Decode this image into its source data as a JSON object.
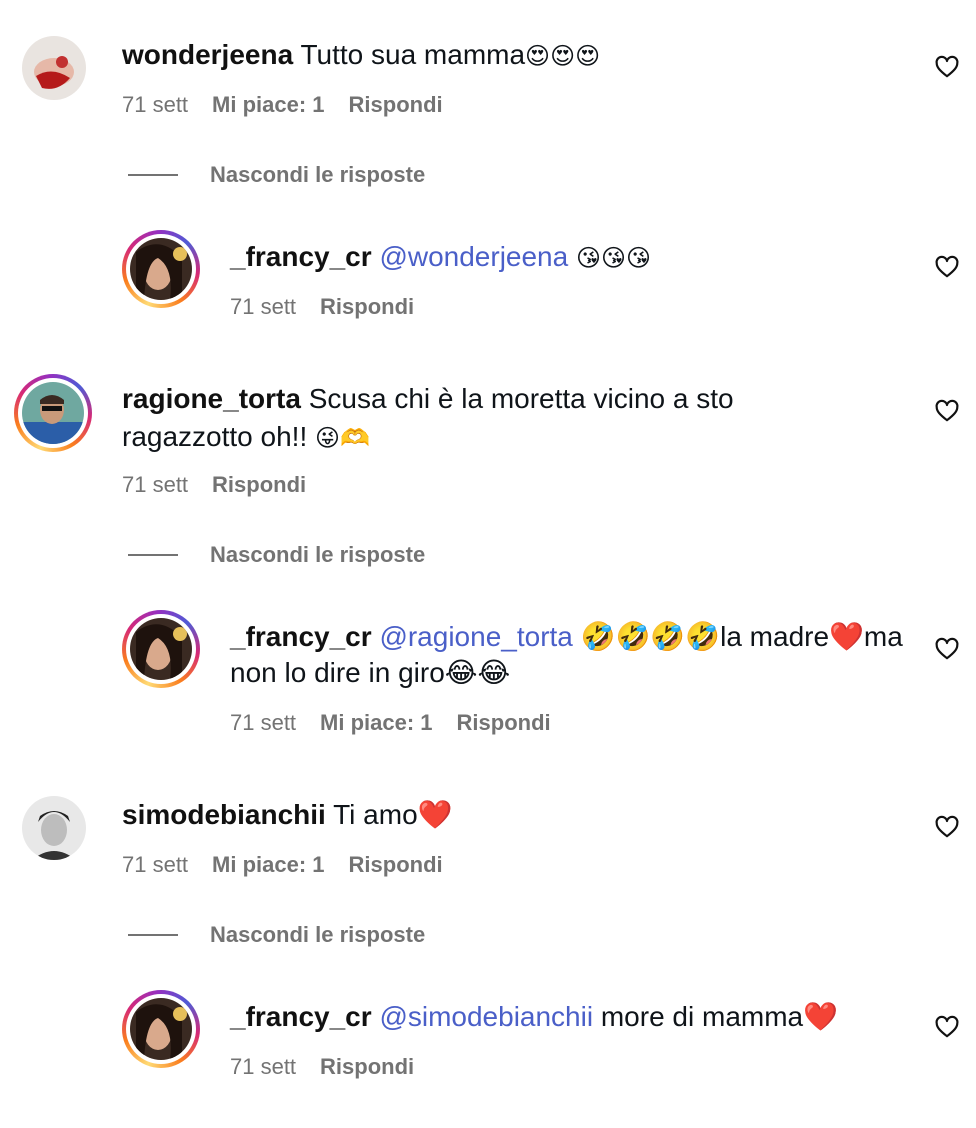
{
  "comments": [
    {
      "username": "wonderjeena",
      "text": "Tutto sua mamma",
      "emoji": "😍😍😍",
      "time": "71 sett",
      "likes": "Mi piace: 1",
      "reply": "Rispondi",
      "toggle": "Nascondi le risposte",
      "replies": [
        {
          "username": "_francy_cr",
          "mention": "@wonderjeena",
          "text": "",
          "emoji": "😘😘😘",
          "time": "71 sett",
          "reply": "Rispondi"
        }
      ]
    },
    {
      "username": "ragione_torta",
      "text": "Scusa chi è la moretta vicino a sto",
      "text2": "ragazzotto oh!!",
      "emoji": "😜🫶",
      "time": "71 sett",
      "reply": "Rispondi",
      "toggle": "Nascondi le risposte",
      "replies": [
        {
          "username": "_francy_cr",
          "mention": "@ragione_torta",
          "text": "🤣🤣🤣🤣la madre❤️ma",
          "text2": "non lo dire in giro😂😂",
          "time": "71 sett",
          "likes": "Mi piace: 1",
          "reply": "Rispondi"
        }
      ]
    },
    {
      "username": "simodebianchii",
      "text": "Ti amo",
      "emoji": "❤️",
      "time": "71 sett",
      "likes": "Mi piace: 1",
      "reply": "Rispondi",
      "toggle": "Nascondi le risposte",
      "replies": [
        {
          "username": "_francy_cr",
          "mention": "@simodebianchii",
          "text": "more di mamma",
          "emoji": "❤️",
          "time": "71 sett",
          "reply": "Rispondi"
        }
      ]
    }
  ],
  "icons": {
    "like": "heart-icon"
  },
  "colors": {
    "mention": "#4a5fc8",
    "meta": "#737373",
    "story_ring": "#d62976"
  }
}
